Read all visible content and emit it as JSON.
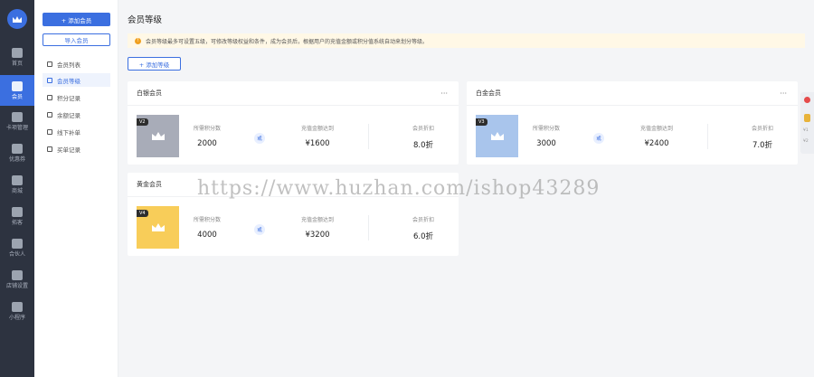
{
  "rail": {
    "items": [
      {
        "label": "首页",
        "icon": "home-icon"
      },
      {
        "label": "会员",
        "icon": "member-icon"
      },
      {
        "label": "卡项管理",
        "icon": "card-icon"
      },
      {
        "label": "优惠券",
        "icon": "coupon-icon"
      },
      {
        "label": "商城",
        "icon": "mall-icon"
      },
      {
        "label": "拓客",
        "icon": "expand-icon"
      },
      {
        "label": "合伙人",
        "icon": "partner-icon"
      },
      {
        "label": "店铺设置",
        "icon": "store-icon"
      },
      {
        "label": "小程序",
        "icon": "miniapp-icon"
      }
    ],
    "active_index": 1
  },
  "sidebar": {
    "add_member": "+ 添加会员",
    "import_member": "导入会员",
    "items": [
      {
        "label": "会员列表"
      },
      {
        "label": "会员等级"
      },
      {
        "label": "积分记录"
      },
      {
        "label": "余额记录"
      },
      {
        "label": "线下补单"
      },
      {
        "label": "买单记录"
      }
    ],
    "active_index": 1
  },
  "main": {
    "title": "会员等级",
    "notice": "会员等级最多可设置五级，可修改等级权益和条件，成为会员后，根据用户的充值金额或积分值系统自动来划分等级。",
    "add_level": "+ 添加等级"
  },
  "stat_labels": {
    "points": "所需积分数",
    "or": "或",
    "recharge": "充值金额达到",
    "discount": "会员折扣"
  },
  "more_label": "···",
  "levels": [
    {
      "name": "白银会员",
      "badge": "V2",
      "points": "2000",
      "recharge": "¥1600",
      "discount": "8.0折",
      "color": "#a8acb8"
    },
    {
      "name": "白金会员",
      "badge": "V3",
      "points": "3000",
      "recharge": "¥2400",
      "discount": "7.0折",
      "color": "#a9c5ec"
    },
    {
      "name": "黄金会员",
      "badge": "V4",
      "points": "4000",
      "recharge": "¥3200",
      "discount": "6.0折",
      "color": "#f8cd59"
    }
  ],
  "float_widget": {
    "t1": "¥1",
    "t2": "¥2"
  },
  "watermark": "https://www.huzhan.com/ishop43289",
  "colors": {
    "primary": "#3b6fe0",
    "rail_bg": "#2d3340",
    "notice_bg": "#fff8e6"
  }
}
